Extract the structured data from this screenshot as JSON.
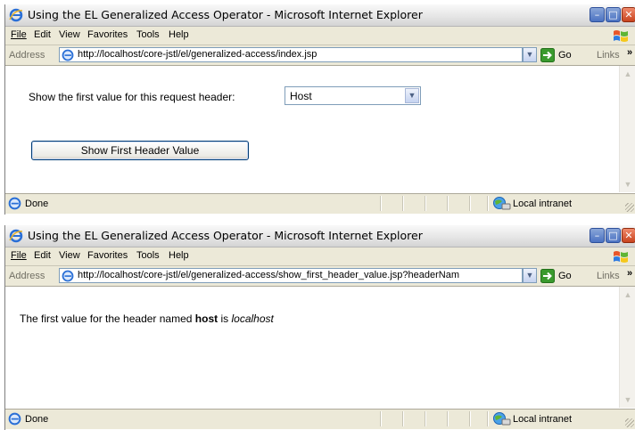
{
  "window1": {
    "title": "Using the EL Generalized Access Operator - Microsoft Internet Explorer",
    "menu": [
      "File",
      "Edit",
      "View",
      "Favorites",
      "Tools",
      "Help"
    ],
    "address_label": "Address",
    "url": "http://localhost/core-jstl/el/generalized-access/index.jsp",
    "go_label": "Go",
    "links_label": "Links",
    "chevron": "»",
    "form_label": "Show the first value for this request header:",
    "select_value": "Host",
    "submit_label": "Show First Header Value",
    "status": "Done",
    "zone": "Local intranet"
  },
  "window2": {
    "title": "Using the EL Generalized Access Operator - Microsoft Internet Explorer",
    "menu": [
      "File",
      "Edit",
      "View",
      "Favorites",
      "Tools",
      "Help"
    ],
    "address_label": "Address",
    "url": "http://localhost/core-jstl/el/generalized-access/show_first_header_value.jsp?headerNam",
    "go_label": "Go",
    "links_label": "Links",
    "chevron": "»",
    "result_prefix": "The first value for the header named",
    "result_header": "host",
    "result_mid": "is",
    "result_value": "localhost",
    "status": "Done",
    "zone": "Local intranet"
  },
  "icons": {
    "app": "ie-logo-icon",
    "windows_logo": "windows-flag-icon",
    "page": "page-icon",
    "go": "go-arrow-icon",
    "zone": "local-intranet-icon"
  },
  "colors": {
    "link_border": "#003c74",
    "field_border": "#7f9db9",
    "chrome": "#ece9d8",
    "go_green": "#3a9a2e"
  }
}
